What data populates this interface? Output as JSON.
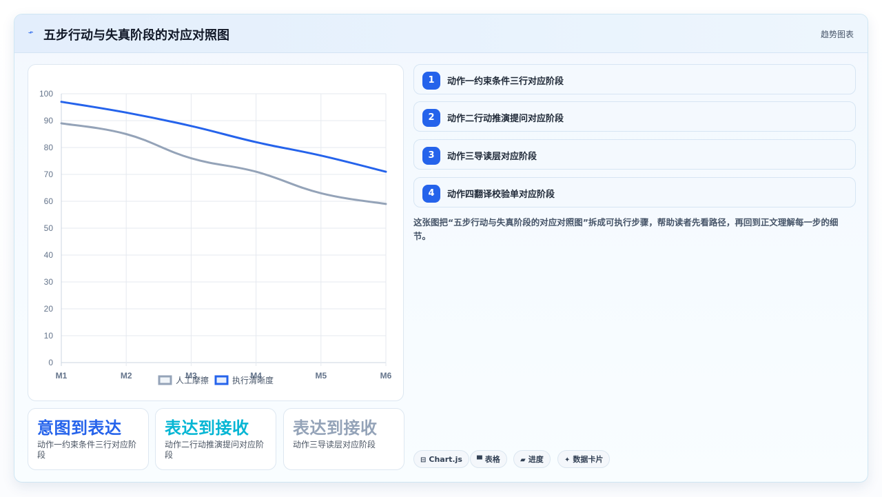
{
  "header": {
    "icon": "sparkle-icon",
    "title": "五步行动与失真阶段的对应对照图",
    "tag": "趋势图表"
  },
  "chart_data": {
    "type": "line",
    "categories": [
      "M1",
      "M2",
      "M3",
      "M4",
      "M5",
      "M6"
    ],
    "y_ticks": [
      "0",
      "10",
      "20",
      "30",
      "40",
      "50",
      "60",
      "70",
      "80",
      "90",
      "100"
    ],
    "ylim": [
      0,
      100
    ],
    "grid": true,
    "legend_position": "bottom",
    "series": [
      {
        "name": "人工摩擦",
        "color": "#94a3b8",
        "values": [
          89,
          85,
          76,
          71,
          63,
          59
        ]
      },
      {
        "name": "执行清晰度",
        "color": "#2563eb",
        "values": [
          97,
          93,
          88,
          82,
          77,
          71
        ]
      }
    ]
  },
  "stats": [
    {
      "title": "意图到表达",
      "desc": "动作一约束条件三行对应阶段",
      "color": "#2563eb"
    },
    {
      "title": "表达到接收",
      "desc": "动作二行动推演提问对应阶段",
      "color": "#06b6d4"
    },
    {
      "title": "表达到接收",
      "desc": "动作三导读层对应阶段",
      "color": "#94a3b8"
    }
  ],
  "steps": [
    {
      "num": "1",
      "label": "动作一约束条件三行对应阶段"
    },
    {
      "num": "2",
      "label": "动作二行动推演提问对应阶段"
    },
    {
      "num": "3",
      "label": "动作三导读层对应阶段"
    },
    {
      "num": "4",
      "label": "动作四翻译校验单对应阶段"
    }
  ],
  "summary": "这张图把“五步行动与失真阶段的对应对照图”拆成可执行步骤，帮助读者先看路径，再回到正文理解每一步的细节。",
  "pills": [
    {
      "icon": "chart-icon",
      "glyph": "⊟",
      "label": "Chart.js"
    },
    {
      "icon": "table-icon",
      "glyph": "▀",
      "label": "表格"
    },
    {
      "icon": "progress-icon",
      "glyph": "▰",
      "label": "进度"
    },
    {
      "icon": "card-icon",
      "glyph": "✦",
      "label": "数据卡片"
    }
  ],
  "colors": {
    "accent": "#2563eb",
    "secondary": "#94a3b8",
    "cyan": "#06b6d4"
  }
}
